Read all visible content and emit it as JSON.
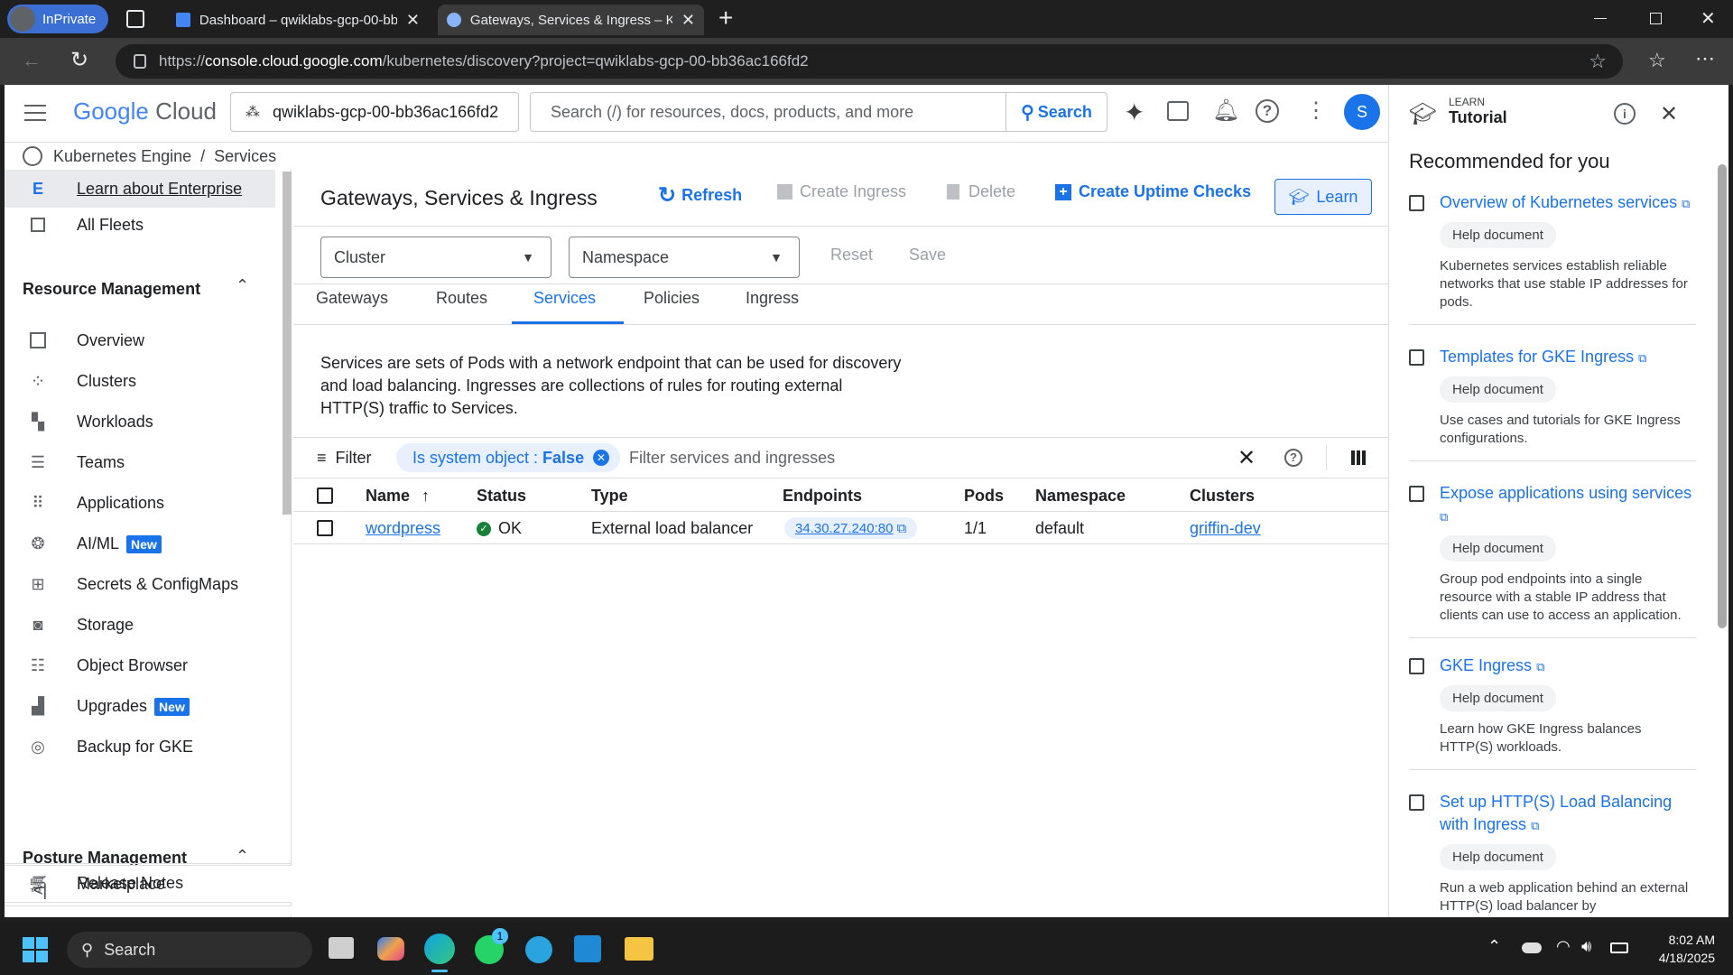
{
  "browser": {
    "inprivate_label": "InPrivate",
    "tabs": [
      {
        "title": "Dashboard – qwiklabs-gcp-00-bb",
        "active": false
      },
      {
        "title": "Gateways, Services & Ingress – Ku",
        "active": true
      }
    ],
    "url_prefix": "https://",
    "url_host": "console.cloud.google.com",
    "url_path": "/kubernetes/discovery?project=qwiklabs-gcp-00-bb36ac166fd2"
  },
  "header": {
    "logo_google": "Google",
    "logo_cloud": "Cloud",
    "project": "qwiklabs-gcp-00-bb36ac166fd2",
    "search_placeholder": "Search (/) for resources, docs, products, and more",
    "search_button": "Search",
    "avatar_letter": "S"
  },
  "breadcrumb": {
    "product": "Kubernetes Engine",
    "sep": "/",
    "page": "Services"
  },
  "sidebar": {
    "enterprise": "Learn about Enterprise",
    "all_fleets": "All Fleets",
    "section_resource": "Resource Management",
    "items": [
      {
        "label": "Overview",
        "icon": "overview-icon"
      },
      {
        "label": "Clusters",
        "icon": "clusters-icon"
      },
      {
        "label": "Workloads",
        "icon": "workloads-icon"
      },
      {
        "label": "Teams",
        "icon": "teams-icon"
      },
      {
        "label": "Applications",
        "icon": "applications-icon"
      },
      {
        "label": "AI/ML",
        "icon": "ai-ml-icon",
        "badge": "New"
      },
      {
        "label": "Secrets & ConfigMaps",
        "icon": "secrets-icon"
      },
      {
        "label": "Storage",
        "icon": "storage-icon"
      },
      {
        "label": "Object Browser",
        "icon": "object-browser-icon"
      },
      {
        "label": "Upgrades",
        "icon": "upgrades-icon",
        "badge": "New"
      },
      {
        "label": "Backup for GKE",
        "icon": "backup-icon"
      }
    ],
    "section_posture": "Posture Management",
    "marketplace": "Marketplace",
    "release_notes": "Release Notes"
  },
  "main": {
    "title": "Gateways, Services & Ingress",
    "actions": {
      "refresh": "Refresh",
      "create_ingress": "Create Ingress",
      "delete": "Delete",
      "create_uptime": "Create Uptime Checks",
      "learn": "Learn"
    },
    "cluster_select": "Cluster",
    "namespace_select": "Namespace",
    "reset": "Reset",
    "save": "Save",
    "tabs": [
      "Gateways",
      "Routes",
      "Services",
      "Policies",
      "Ingress"
    ],
    "active_tab": "Services",
    "description": "Services are sets of Pods with a network endpoint that can be used for discovery and load balancing. Ingresses are collections of rules for routing external HTTP(S) traffic to Services.",
    "filter_label": "Filter",
    "filter_chip_key": "Is system object : ",
    "filter_chip_value": "False",
    "filter_placeholder": "Filter services and ingresses",
    "table": {
      "columns": [
        "Name",
        "Status",
        "Type",
        "Endpoints",
        "Pods",
        "Namespace",
        "Clusters"
      ],
      "rows": [
        {
          "name": "wordpress",
          "status": "OK",
          "type": "External load balancer",
          "endpoints": "34.30.27.240:80",
          "pods": "1/1",
          "namespace": "default",
          "clusters": "griffin-dev"
        }
      ]
    }
  },
  "panel": {
    "eyebrow": "LEARN",
    "title": "Tutorial",
    "heading": "Recommended for you",
    "chip": "Help document",
    "items": [
      {
        "title": "Overview of Kubernetes services",
        "desc": "Kubernetes services establish reliable networks that use stable IP addresses for pods."
      },
      {
        "title": "Templates for GKE Ingress",
        "desc": "Use cases and tutorials for GKE Ingress configurations."
      },
      {
        "title": "Expose applications using services",
        "desc": "Group pod endpoints into a single resource with a stable IP address that clients can use to access an application."
      },
      {
        "title": "GKE Ingress",
        "desc": "Learn how GKE Ingress balances HTTP(S) workloads."
      },
      {
        "title": "Set up HTTP(S) Load Balancing with Ingress",
        "desc": "Run a web application behind an external HTTP(S) load balancer by"
      }
    ]
  },
  "taskbar": {
    "search": "Search",
    "time": "8:02 AM",
    "date": "4/18/2025",
    "whatsapp_badge": "1"
  },
  "colors": {
    "accent": "#1a73e8",
    "ok": "#188038",
    "badge": "#1a73e8"
  }
}
